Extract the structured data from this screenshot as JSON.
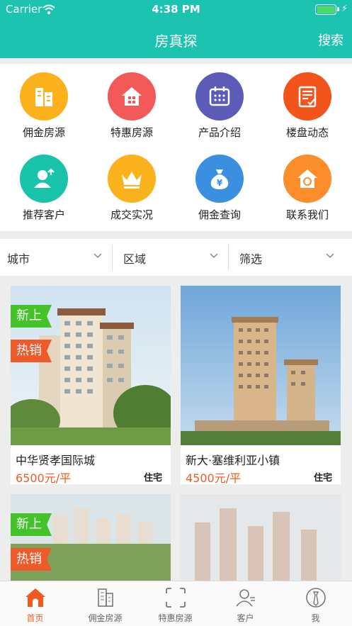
{
  "status": {
    "carrier": "Carrier",
    "time": "4:38 PM"
  },
  "nav": {
    "title": "房真探",
    "search": "搜索"
  },
  "grid": [
    {
      "label": "佣金房源",
      "color": "#fbb21d",
      "icon": "buildings-icon"
    },
    {
      "label": "特惠房源",
      "color": "#f25a5a",
      "icon": "house-icon"
    },
    {
      "label": "产品介绍",
      "color": "#5c5bb7",
      "icon": "calendar-icon"
    },
    {
      "label": "楼盘动态",
      "color": "#f2541b",
      "icon": "document-icon"
    },
    {
      "label": "推荐客户",
      "color": "#19c3a9",
      "icon": "add-user-icon"
    },
    {
      "label": "成交实况",
      "color": "#fbb21d",
      "icon": "crown-icon"
    },
    {
      "label": "佣金查询",
      "color": "#3b8fe0",
      "icon": "money-bag-icon"
    },
    {
      "label": "联系我们",
      "color": "#fb8d2a",
      "icon": "home-contact-icon"
    }
  ],
  "filters": [
    {
      "label": "城市"
    },
    {
      "label": "区域"
    },
    {
      "label": "筛选"
    }
  ],
  "tags": {
    "new": "新上",
    "hot": "热销"
  },
  "listings": [
    {
      "name": "中华贤孝国际城",
      "price": "6500元/平",
      "type": "住宅"
    },
    {
      "name": "新大·塞维利亚小镇",
      "price": "4500元/平",
      "type": "住宅"
    }
  ],
  "tabs": [
    {
      "label": "首页",
      "active": true
    },
    {
      "label": "佣金房源"
    },
    {
      "label": "特惠房源"
    },
    {
      "label": "客户"
    },
    {
      "label": "我"
    }
  ],
  "colors": {
    "primary": "#1cc3b0",
    "accent": "#f05a22"
  }
}
